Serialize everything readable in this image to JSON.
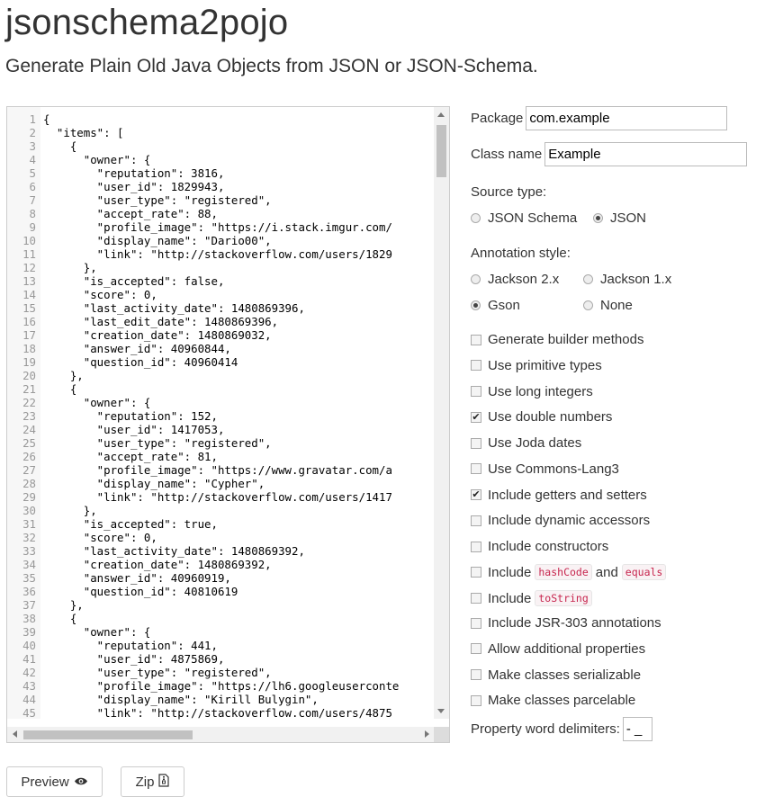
{
  "header": {
    "title": "jsonschema2pojo",
    "subtitle": "Generate Plain Old Java Objects from JSON or JSON-Schema."
  },
  "editor": {
    "lines": [
      "{",
      "  \"items\": [",
      "    {",
      "      \"owner\": {",
      "        \"reputation\": 3816,",
      "        \"user_id\": 1829943,",
      "        \"user_type\": \"registered\",",
      "        \"accept_rate\": 88,",
      "        \"profile_image\": \"https://i.stack.imgur.com/",
      "        \"display_name\": \"Dario00\",",
      "        \"link\": \"http://stackoverflow.com/users/1829",
      "      },",
      "      \"is_accepted\": false,",
      "      \"score\": 0,",
      "      \"last_activity_date\": 1480869396,",
      "      \"last_edit_date\": 1480869396,",
      "      \"creation_date\": 1480869032,",
      "      \"answer_id\": 40960844,",
      "      \"question_id\": 40960414",
      "    },",
      "    {",
      "      \"owner\": {",
      "        \"reputation\": 152,",
      "        \"user_id\": 1417053,",
      "        \"user_type\": \"registered\",",
      "        \"accept_rate\": 81,",
      "        \"profile_image\": \"https://www.gravatar.com/a",
      "        \"display_name\": \"Cypher\",",
      "        \"link\": \"http://stackoverflow.com/users/1417",
      "      },",
      "      \"is_accepted\": true,",
      "      \"score\": 0,",
      "      \"last_activity_date\": 1480869392,",
      "      \"creation_date\": 1480869392,",
      "      \"answer_id\": 40960919,",
      "      \"question_id\": 40810619",
      "    },",
      "    {",
      "      \"owner\": {",
      "        \"reputation\": 441,",
      "        \"user_id\": 4875869,",
      "        \"user_type\": \"registered\",",
      "        \"profile_image\": \"https://lh6.googleuserconte",
      "        \"display_name\": \"Kirill Bulygin\",",
      "        \"link\": \"http://stackoverflow.com/users/4875"
    ]
  },
  "options": {
    "package_label": "Package",
    "package_value": "com.example",
    "classname_label": "Class name",
    "classname_value": "Example",
    "source_type_label": "Source type:",
    "source_types": [
      {
        "label": "JSON Schema",
        "selected": false
      },
      {
        "label": "JSON",
        "selected": true
      }
    ],
    "annotation_label": "Annotation style:",
    "annotation_styles": [
      {
        "label": "Jackson 2.x",
        "selected": false
      },
      {
        "label": "Jackson 1.x",
        "selected": false
      },
      {
        "label": "Gson",
        "selected": true
      },
      {
        "label": "None",
        "selected": false
      }
    ],
    "checkboxes": [
      {
        "label": "Generate builder methods",
        "checked": false
      },
      {
        "label": "Use primitive types",
        "checked": false
      },
      {
        "label": "Use long integers",
        "checked": false
      },
      {
        "label": "Use double numbers",
        "checked": true
      },
      {
        "label": "Use Joda dates",
        "checked": false
      },
      {
        "label": "Use Commons-Lang3",
        "checked": false
      },
      {
        "label": "Include getters and setters",
        "checked": true
      },
      {
        "label": "Include dynamic accessors",
        "checked": false
      },
      {
        "label": "Include constructors",
        "checked": false
      }
    ],
    "hash_include": "Include",
    "hash_code": "hashCode",
    "hash_and": "and",
    "hash_equals": "equals",
    "tostring_include": "Include",
    "tostring_code": "toString",
    "checkboxes2": [
      {
        "label": "Include JSR-303 annotations",
        "checked": false
      },
      {
        "label": "Allow additional properties",
        "checked": false
      },
      {
        "label": "Make classes serializable",
        "checked": false
      },
      {
        "label": "Make classes parcelable",
        "checked": false
      }
    ],
    "delimiters_label": "Property word delimiters:",
    "delimiters_value": "- _"
  },
  "buttons": {
    "preview": "Preview",
    "zip": "Zip"
  }
}
